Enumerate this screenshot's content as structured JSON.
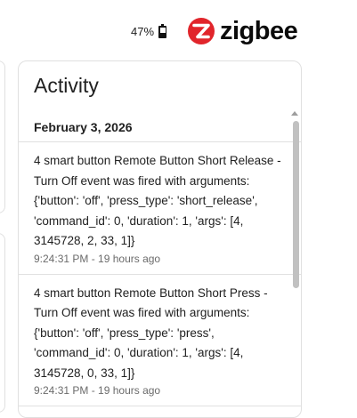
{
  "status": {
    "battery_percent": "47%"
  },
  "brand": {
    "name": "zigbee",
    "color": "#e1252b"
  },
  "activity": {
    "title": "Activity",
    "date": "February 3, 2026",
    "events": [
      {
        "text": "4 smart button Remote Button Short Release - Turn Off event was fired with arguments: {'button': 'off', 'press_type': 'short_release', 'command_id': 0, 'duration': 1, 'args': [4, 3145728, 2, 33, 1]}",
        "time": "9:24:31 PM - 19 hours ago"
      },
      {
        "text": "4 smart button Remote Button Short Press - Turn Off event was fired with arguments: {'button': 'off', 'press_type': 'press', 'command_id': 0, 'duration': 1, 'args': [4, 3145728, 0, 33, 1]}",
        "time": "9:24:31 PM - 19 hours ago"
      }
    ]
  },
  "icons": {
    "battery": "battery-icon",
    "logo": "zigbee-logo-icon",
    "scroll": "scroll-up-arrow-icon"
  }
}
